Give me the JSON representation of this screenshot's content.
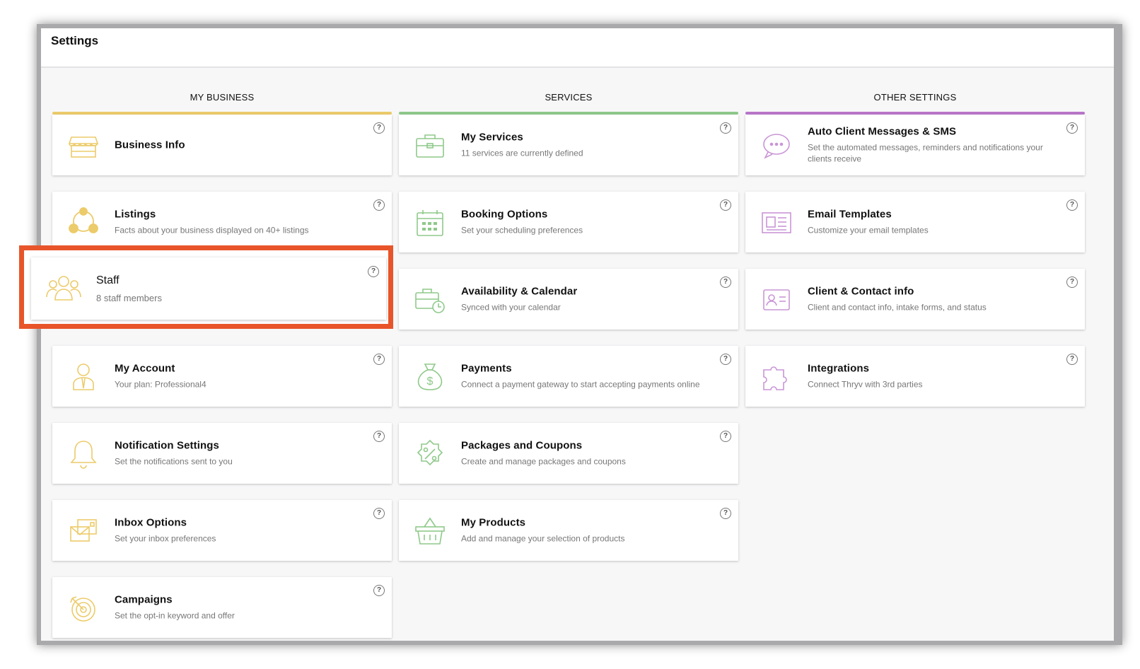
{
  "page": {
    "title": "Settings"
  },
  "help_glyph": "?",
  "colors": {
    "business": "#eccb6a",
    "services": "#8fc98a",
    "other": "#b877c9",
    "highlight": "#e8552a"
  },
  "columns": [
    {
      "header": "MY BUSINESS",
      "cards": [
        {
          "title": "Business Info",
          "subtitle": "",
          "icon": "storefront-icon"
        },
        {
          "title": "Listings",
          "subtitle": "Facts about your business displayed on 40+ listings",
          "icon": "network-icon"
        },
        {
          "title": "Staff",
          "subtitle": "8 staff members",
          "icon": "people-icon"
        },
        {
          "title": "My Account",
          "subtitle": "Your plan: Professional4",
          "icon": "user-icon"
        },
        {
          "title": "Notification Settings",
          "subtitle": "Set the notifications sent to you",
          "icon": "bell-icon"
        },
        {
          "title": "Inbox Options",
          "subtitle": "Set your inbox preferences",
          "icon": "inbox-icon"
        },
        {
          "title": "Campaigns",
          "subtitle": "Set the opt-in keyword and offer",
          "icon": "target-icon"
        }
      ]
    },
    {
      "header": "SERVICES",
      "cards": [
        {
          "title": "My Services",
          "subtitle": "11 services are currently defined",
          "icon": "briefcase-icon"
        },
        {
          "title": "Booking Options",
          "subtitle": "Set your scheduling preferences",
          "icon": "calendar-icon"
        },
        {
          "title": "Availability & Calendar",
          "subtitle": "Synced with your calendar",
          "icon": "briefcase-clock-icon"
        },
        {
          "title": "Payments",
          "subtitle": "Connect a payment gateway to start accepting payments online",
          "icon": "money-bag-icon"
        },
        {
          "title": "Packages and Coupons",
          "subtitle": "Create and manage packages and coupons",
          "icon": "coupon-icon"
        },
        {
          "title": "My Products",
          "subtitle": "Add and manage your selection of products",
          "icon": "basket-icon"
        }
      ]
    },
    {
      "header": "OTHER SETTINGS",
      "cards": [
        {
          "title": "Auto Client Messages & SMS",
          "subtitle": "Set the automated messages, reminders and notifications your clients receive",
          "icon": "chat-bubble-icon"
        },
        {
          "title": "Email Templates",
          "subtitle": "Customize your email templates",
          "icon": "newspaper-icon"
        },
        {
          "title": "Client & Contact info",
          "subtitle": "Client and contact info, intake forms, and status",
          "icon": "id-card-icon"
        },
        {
          "title": "Integrations",
          "subtitle": "Connect Thryv with 3rd parties",
          "icon": "puzzle-icon"
        }
      ]
    }
  ]
}
